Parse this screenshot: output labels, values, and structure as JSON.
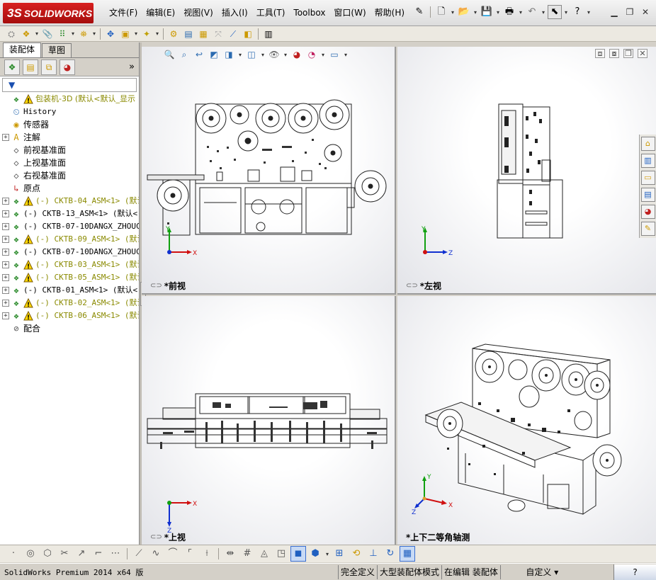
{
  "app": {
    "logo_text": "SOLIDWORKS",
    "logo_mark": "3S",
    "brand_color": "#c4161c"
  },
  "menus": [
    "文件(F)",
    "编辑(E)",
    "视图(V)",
    "插入(I)",
    "工具(T)",
    "Toolbox",
    "窗口(W)",
    "帮助(H)"
  ],
  "title_tools": {
    "help_glyph": "?"
  },
  "panel": {
    "tabs": [
      "装配体",
      "草图"
    ],
    "active_tab": "装配体",
    "more_glyph": "»",
    "filter_glyph": "▼"
  },
  "tree": {
    "root": "包装机-3D  (默认<默认_显示",
    "items": [
      {
        "label": "History",
        "expand": false,
        "icon": "history-icon",
        "warn": false
      },
      {
        "label": "传感器",
        "expand": false,
        "icon": "sensor-icon",
        "warn": false
      },
      {
        "label": "注解",
        "expand": true,
        "icon": "annotation-icon",
        "warn": false
      },
      {
        "label": "前视基准面",
        "expand": false,
        "icon": "plane-icon",
        "warn": false
      },
      {
        "label": "上视基准面",
        "expand": false,
        "icon": "plane-icon",
        "warn": false
      },
      {
        "label": "右视基准面",
        "expand": false,
        "icon": "plane-icon",
        "warn": false
      },
      {
        "label": "原点",
        "expand": false,
        "icon": "origin-icon",
        "warn": false
      },
      {
        "label": "(-) CKTB-04_ASM<1> (默认",
        "expand": true,
        "icon": "subassembly-icon",
        "warn": true
      },
      {
        "label": "(-) CKTB-13_ASM<1> (默认<",
        "expand": true,
        "icon": "subassembly-icon",
        "warn": false
      },
      {
        "label": "(-) CKTB-07-10DANGX_ZHOUC",
        "expand": true,
        "icon": "subassembly-icon",
        "warn": false
      },
      {
        "label": "(-) CKTB-09_ASM<1> (默认",
        "expand": true,
        "icon": "subassembly-icon",
        "warn": true
      },
      {
        "label": "(-) CKTB-07-10DANGX_ZHOUC",
        "expand": true,
        "icon": "subassembly-icon",
        "warn": false
      },
      {
        "label": "(-) CKTB-03_ASM<1> (默认",
        "expand": true,
        "icon": "subassembly-icon",
        "warn": true
      },
      {
        "label": "(-) CKTB-05_ASM<1> (默认",
        "expand": true,
        "icon": "subassembly-icon",
        "warn": true
      },
      {
        "label": "(-) CKTB-01_ASM<1> (默认<",
        "expand": true,
        "icon": "subassembly-icon",
        "warn": false
      },
      {
        "label": "(-) CKTB-02_ASM<1> (默认",
        "expand": true,
        "icon": "subassembly-icon",
        "warn": true
      },
      {
        "label": "(-) CKTB-06_ASM<1> (默认",
        "expand": true,
        "icon": "subassembly-icon",
        "warn": true
      },
      {
        "label": "配合",
        "expand": false,
        "icon": "mates-icon",
        "warn": false
      }
    ]
  },
  "views": {
    "front": "*前视",
    "left": "*左视",
    "top": "*上视",
    "iso": "*上下二等角轴测"
  },
  "axes": {
    "x": "X",
    "y": "Y",
    "z": "Z",
    "x_color": "#d01010",
    "y_color": "#10a010",
    "z_color": "#1030d0"
  },
  "status": {
    "app": "SolidWorks Premium 2014 x64 版",
    "fully_defined": "完全定义",
    "large_assembly": "大型装配体模式",
    "editing": "在编辑 装配体",
    "units": "自定义",
    "units_caret": "▾",
    "help": "?"
  }
}
